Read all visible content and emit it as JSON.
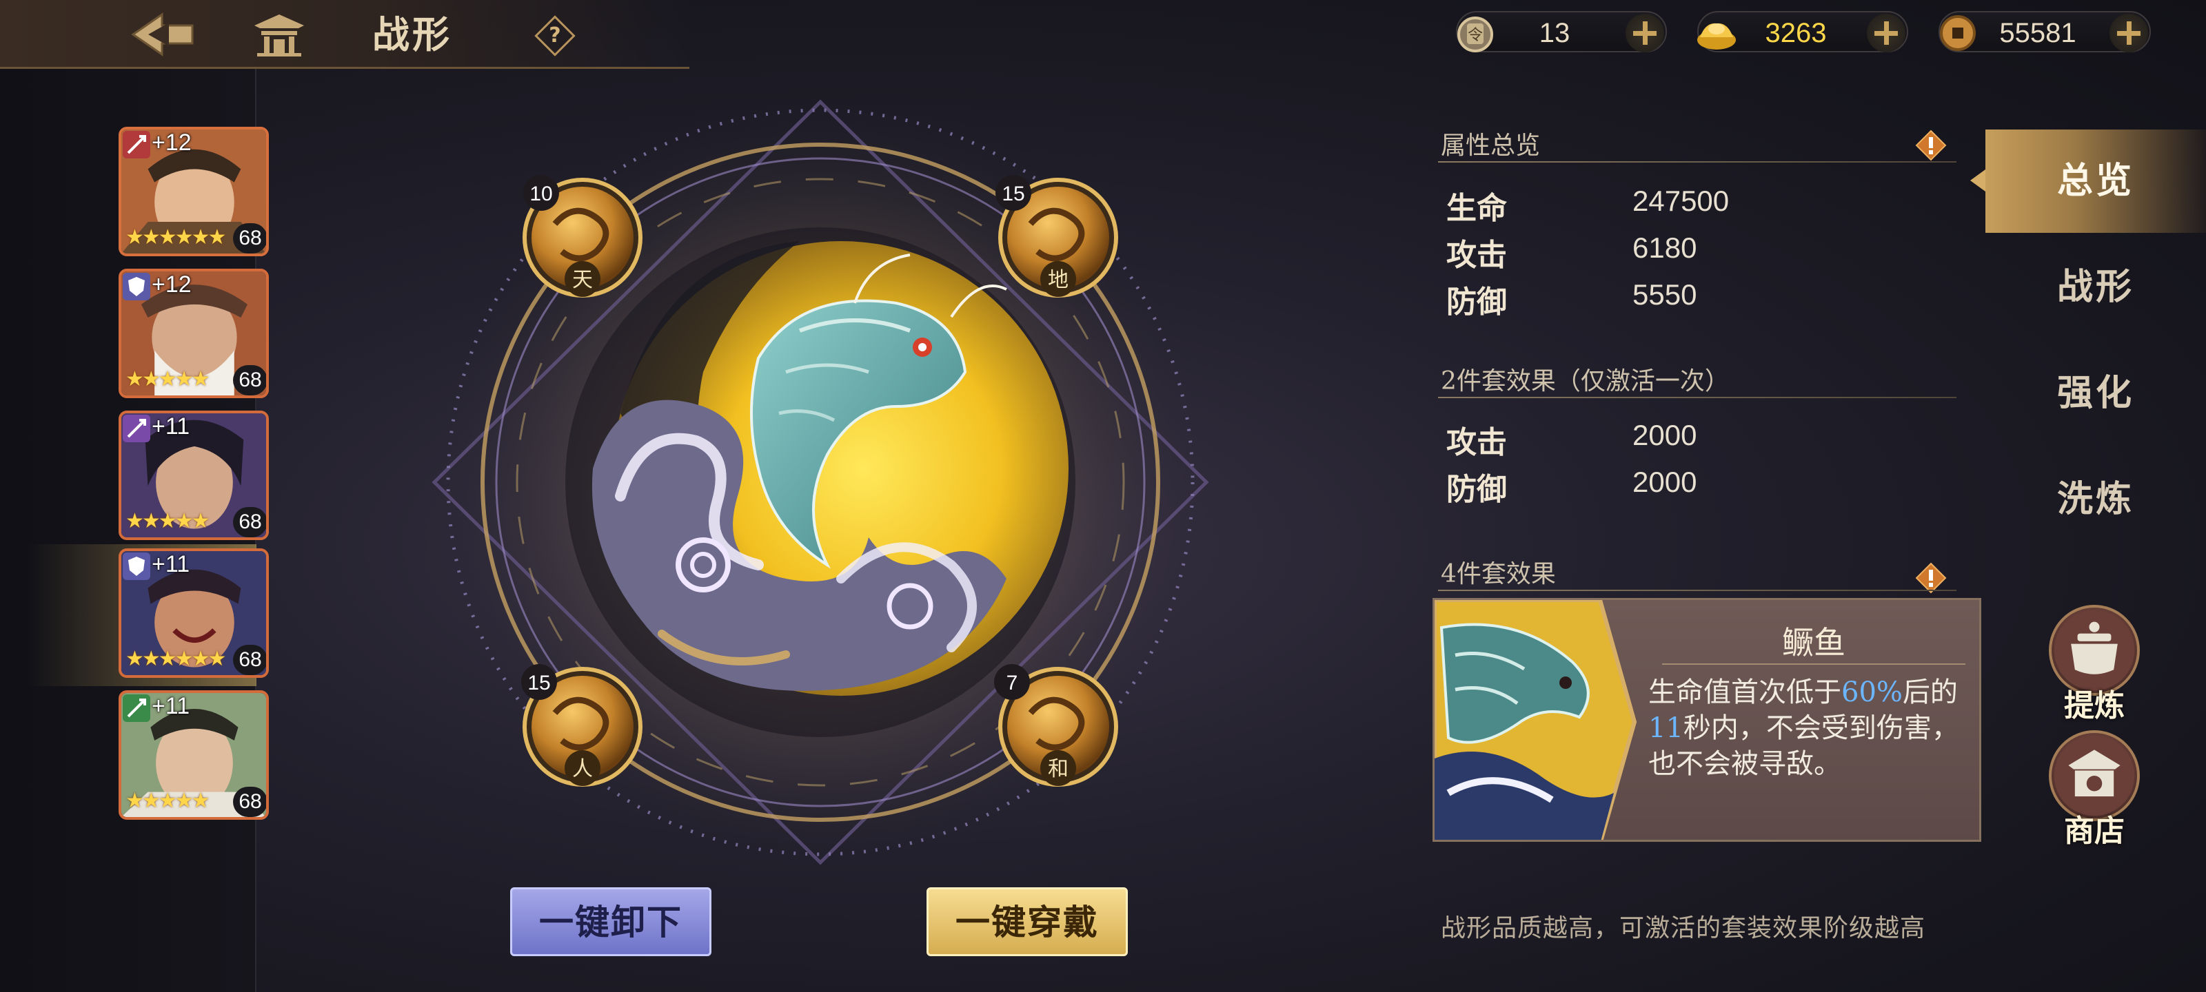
{
  "header": {
    "title": "战形",
    "help_symbol": "?"
  },
  "currencies": [
    {
      "name": "token",
      "value": "13"
    },
    {
      "name": "ingot",
      "value": "3263",
      "color": "#ffd84a"
    },
    {
      "name": "coin",
      "value": "55581"
    }
  ],
  "roster": [
    {
      "level": "+12",
      "stars": "★★★★★★",
      "num": "68",
      "badge": "spear"
    },
    {
      "level": "+12",
      "stars": "★★★★★",
      "num": "68",
      "badge": "shield"
    },
    {
      "level": "+11",
      "stars": "★★★★★",
      "num": "68",
      "badge": "spear"
    },
    {
      "level": "+11",
      "stars": "★★★★★★",
      "num": "68",
      "badge": "shield",
      "selected": true
    },
    {
      "level": "+11",
      "stars": "★★★★★",
      "num": "68",
      "badge": "spear"
    }
  ],
  "formation": {
    "slots": [
      {
        "glyph": "天",
        "level": "10"
      },
      {
        "glyph": "地",
        "level": "15"
      },
      {
        "glyph": "人",
        "level": "15"
      },
      {
        "glyph": "和",
        "level": "7"
      }
    ],
    "unequip_label": "一键卸下",
    "equip_label": "一键穿戴"
  },
  "info": {
    "overview_title": "属性总览",
    "stats": [
      {
        "label": "生命",
        "value": "247500"
      },
      {
        "label": "攻击",
        "value": "6180"
      },
      {
        "label": "防御",
        "value": "5550"
      }
    ],
    "set2_title": "2件套效果（仅激活一次）",
    "set2_stats": [
      {
        "label": "攻击",
        "value": "2000"
      },
      {
        "label": "防御",
        "value": "2000"
      }
    ],
    "set4_title": "4件套效果",
    "set4_name": "鳜鱼",
    "set4_desc_1": "生命值首次低于",
    "set4_desc_pct": "60%",
    "set4_desc_2": "后的",
    "set4_desc_sec": "11",
    "set4_desc_3": "秒内，不会受到伤害，也不会被寻敌。",
    "footnote": "战形品质越高，可激活的套装效果阶级越高"
  },
  "tabs": [
    {
      "label": "总览",
      "active": true
    },
    {
      "label": "战形"
    },
    {
      "label": "强化"
    },
    {
      "label": "洗炼"
    }
  ],
  "side_buttons": [
    {
      "label": "提炼",
      "icon": "cauldron-icon"
    },
    {
      "label": "商店",
      "icon": "shop-icon"
    }
  ],
  "colors": {
    "accent_gold": "#d7ae68",
    "highlight_blue": "#6cb6ff",
    "unequip_button": "#8a8de0",
    "equip_button": "#e8c46e"
  }
}
